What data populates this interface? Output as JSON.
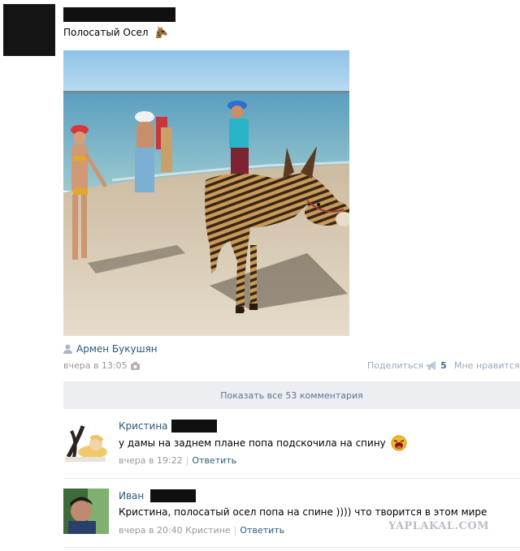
{
  "post": {
    "text": "Полосатый Осел",
    "author": "Армен Букушян",
    "date": "вчера в 13:05",
    "share_label": "Поделиться",
    "share_count": "5",
    "like_label": "Мне нравится"
  },
  "comments_bar": {
    "show_all": "Показать все 53 комментария"
  },
  "comments": [
    {
      "name": "Кристина",
      "text": "у дамы на заднем плане попа подскочила на спину",
      "date": "вчера в 19:22",
      "reply_to": "",
      "reply_label": "Ответить"
    },
    {
      "name": "Иван",
      "text": "Кристина, полосатый осел попа на спине )))) что творится в этом мире",
      "date": "вчера в 20:40",
      "reply_to": "Кристине",
      "reply_label": "Ответить"
    }
  ],
  "watermark": "YAPLAKAL.COM",
  "icons": {
    "post_emoji": "donkey-emoji-icon",
    "author": "user-icon",
    "date": "camera-icon",
    "share": "megaphone-icon",
    "comment_emoji": "laughing-face-icon"
  }
}
